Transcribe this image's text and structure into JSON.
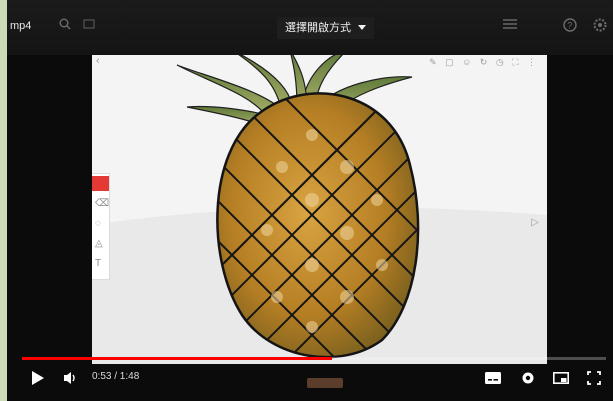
{
  "window": {
    "filename": "mp4"
  },
  "topbar": {
    "search_icon": "search-icon",
    "search_text": "",
    "open_with_label": "選擇開啟方式",
    "dropdown_icon": "caret-down-icon",
    "right_icons": [
      "list-icon",
      "help-icon",
      "settings-icon"
    ]
  },
  "canvas": {
    "top_toolbar_icons": [
      "pencil-icon",
      "document-icon",
      "user-icon",
      "refresh-icon",
      "clock-icon",
      "expand-icon",
      "more-icon"
    ],
    "tools": [
      "pen",
      "eraser",
      "lasso",
      "fill",
      "text"
    ]
  },
  "player": {
    "current_time": "0:53",
    "duration": "1:48",
    "time_text": "0:53 / 1:48",
    "progress": 0.53,
    "controls": [
      "play-icon",
      "volume-icon",
      "subtitles-icon",
      "settings-icon",
      "miniplayer-icon",
      "fullscreen-icon"
    ]
  },
  "colors": {
    "progress": "#ff0000",
    "frame": "#0b0b0b",
    "page_bg": "#c9dcb6",
    "active_tool": "#e53935"
  }
}
